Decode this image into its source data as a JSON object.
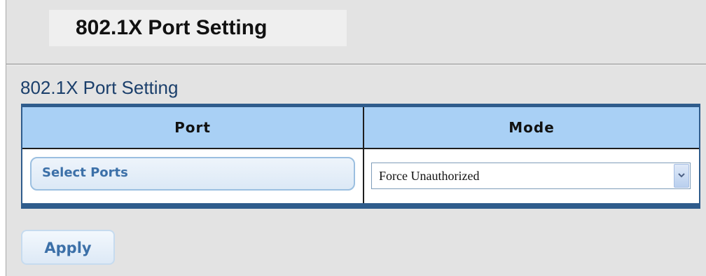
{
  "page": {
    "title": "802.1X Port Setting"
  },
  "section": {
    "title": "802.1X Port Setting"
  },
  "table": {
    "columns": [
      "Port",
      "Mode"
    ],
    "row": {
      "port_button_label": "Select Ports",
      "mode_value": "Force Unauthorized"
    }
  },
  "actions": {
    "apply_label": "Apply"
  },
  "icons": {
    "dropdown": "chevron-down-icon"
  },
  "colors": {
    "header_bg": "#a9d0f5",
    "table_border": "#2f5c8c",
    "section_title": "#1b3f6b",
    "button_text": "#3c70a8"
  }
}
